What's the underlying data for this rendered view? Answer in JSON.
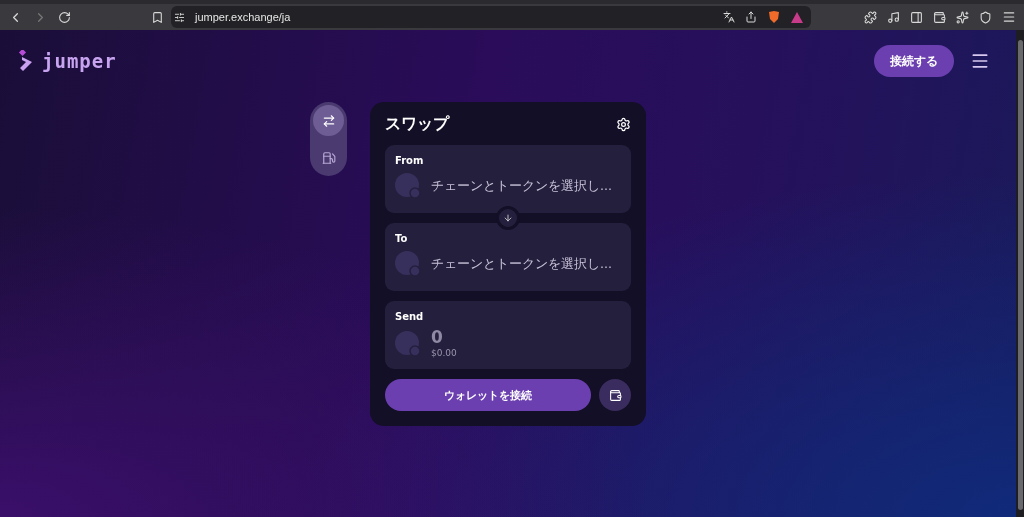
{
  "browser": {
    "url": "jumper.exchange/ja"
  },
  "header": {
    "logo": "jumper",
    "connect_button": "接続する"
  },
  "side_nav": [
    {
      "kind": "swap",
      "selected": true
    },
    {
      "kind": "gas",
      "selected": false
    }
  ],
  "swap": {
    "title": "スワップ",
    "from": {
      "label": "From",
      "prompt": "チェーンとトークンを選択し..."
    },
    "to": {
      "label": "To",
      "prompt": "チェーンとトークンを選択し..."
    },
    "send": {
      "label": "Send",
      "amount": "0",
      "usd": "$0.00"
    },
    "wallet_button": "ウォレットを接続"
  }
}
